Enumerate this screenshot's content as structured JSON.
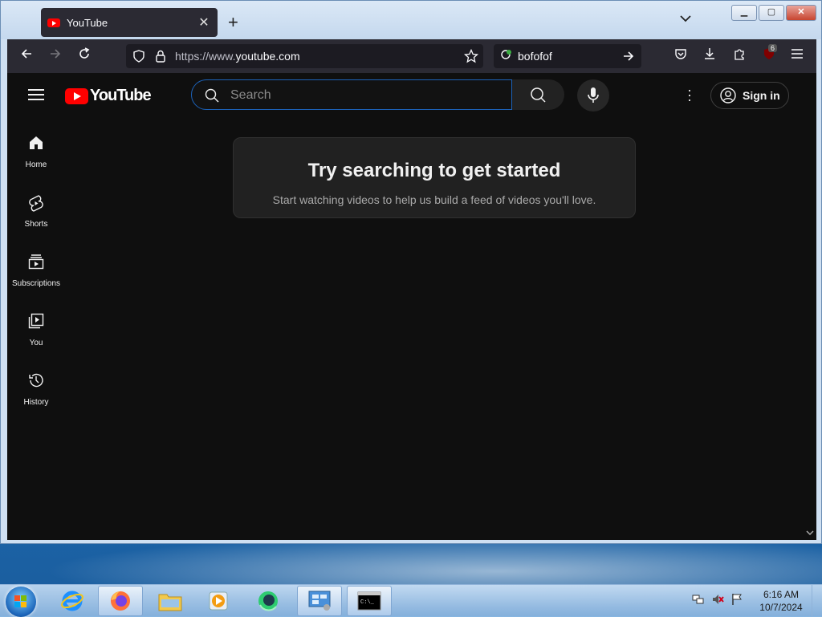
{
  "browser": {
    "tab_title": "YouTube",
    "url_prefix": "https://www.",
    "url_domain": "youtube.com",
    "search_engine_text": "bofofof",
    "extension_badge": "6"
  },
  "youtube": {
    "logo_text": "YouTube",
    "search_placeholder": "Search",
    "sign_in_label": "Sign in",
    "sidebar": [
      {
        "label": "Home",
        "icon": "home-icon"
      },
      {
        "label": "Shorts",
        "icon": "shorts-icon"
      },
      {
        "label": "Subscriptions",
        "icon": "subscriptions-icon"
      },
      {
        "label": "You",
        "icon": "you-icon"
      },
      {
        "label": "History",
        "icon": "history-icon"
      }
    ],
    "empty_state": {
      "heading": "Try searching to get started",
      "subtext": "Start watching videos to help us build a feed of videos you'll love."
    }
  },
  "taskbar": {
    "time": "6:16 AM",
    "date": "10/7/2024",
    "apps": [
      "internet-explorer",
      "firefox",
      "file-explorer",
      "media-player",
      "browser-app",
      "control-panel",
      "command-prompt"
    ]
  },
  "colors": {
    "yt_background": "#0f0f0f",
    "yt_red": "#ff0000",
    "browser_chrome": "#2b2a33"
  }
}
